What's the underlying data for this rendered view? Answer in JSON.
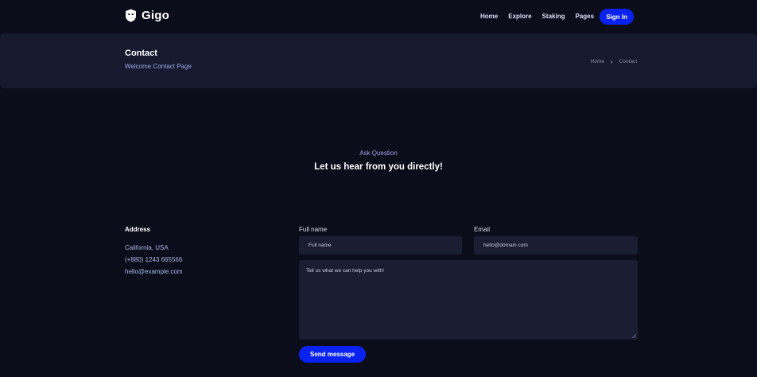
{
  "brand": {
    "name": "Gigo",
    "logo_icon": "lion-shield-icon"
  },
  "nav": {
    "items": [
      {
        "label": "Home"
      },
      {
        "label": "Explore"
      },
      {
        "label": "Staking"
      },
      {
        "label": "Pages"
      }
    ],
    "signin_label": "Sign In"
  },
  "page_header": {
    "title": "Contact",
    "subtitle": "Welcome Contact Page",
    "breadcrumb": {
      "home": "Home",
      "separator": "›",
      "current": "Contact"
    }
  },
  "section": {
    "eyebrow": "Ask Question",
    "heading": "Let us hear from you directly!"
  },
  "address": {
    "title": "Address",
    "location": "California, USA",
    "phone": "(+880) 1243 665566",
    "email": "hello@example.com"
  },
  "form": {
    "name_label": "Full name",
    "name_placeholder": "Full name",
    "email_label": "Email",
    "email_placeholder": "hello@domain.com",
    "message_placeholder": "Tell us what we can help you with!",
    "submit_label": "Send message"
  },
  "colors": {
    "background": "#0b0d1a",
    "panel": "#161a2e",
    "input": "#1a1e33",
    "accent": "#0a22f0",
    "muted_text": "#9fa6e8"
  }
}
